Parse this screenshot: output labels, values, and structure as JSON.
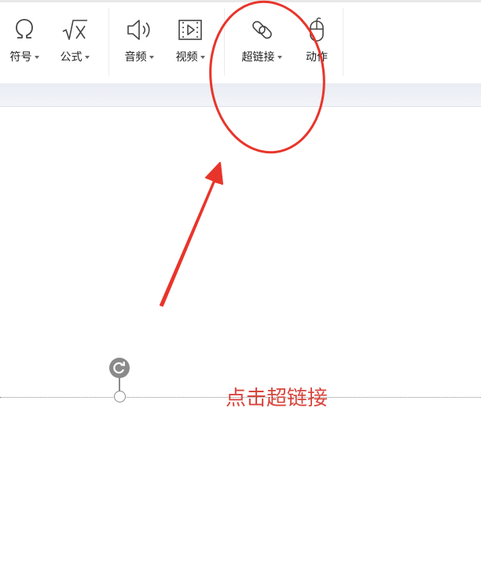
{
  "ribbon": {
    "tools": [
      {
        "id": "symbol",
        "label": "符号",
        "icon": "omega-icon",
        "has_dropdown": true
      },
      {
        "id": "formula",
        "label": "公式",
        "icon": "sqrt-x-icon",
        "has_dropdown": true
      },
      {
        "id": "audio",
        "label": "音频",
        "icon": "speaker-icon",
        "has_dropdown": true
      },
      {
        "id": "video",
        "label": "视频",
        "icon": "film-icon",
        "has_dropdown": true
      },
      {
        "id": "hyperlink",
        "label": "超链接",
        "icon": "chain-link-icon",
        "has_dropdown": true
      },
      {
        "id": "action",
        "label": "动作",
        "icon": "mouse-icon",
        "has_dropdown": false
      }
    ]
  },
  "slide": {
    "instruction_text": "点击超链接"
  },
  "colors": {
    "annotation_red": "#e8352b",
    "instruction_red": "#d8453d",
    "handle_gray": "#8a8a8a"
  }
}
